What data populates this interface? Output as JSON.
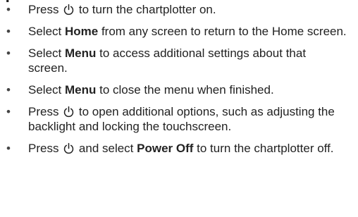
{
  "bullet_glyph": "•",
  "icons": {
    "power": "power-icon"
  },
  "bullets": [
    {
      "parts": [
        "Press ",
        " to turn the chartplotter on."
      ]
    },
    {
      "parts": [
        "Select ",
        "Home",
        " from any screen to return to the Home screen."
      ]
    },
    {
      "parts": [
        "Select ",
        "Menu",
        " to access additional settings about that screen."
      ]
    },
    {
      "parts": [
        "Select ",
        "Menu",
        " to close the menu when finished."
      ]
    },
    {
      "parts": [
        "Press ",
        " to open additional options, such as adjusting the backlight and locking the touchscreen."
      ]
    },
    {
      "parts": [
        "Press ",
        " and select ",
        "Power Off",
        " to turn the chartplotter off."
      ]
    }
  ]
}
